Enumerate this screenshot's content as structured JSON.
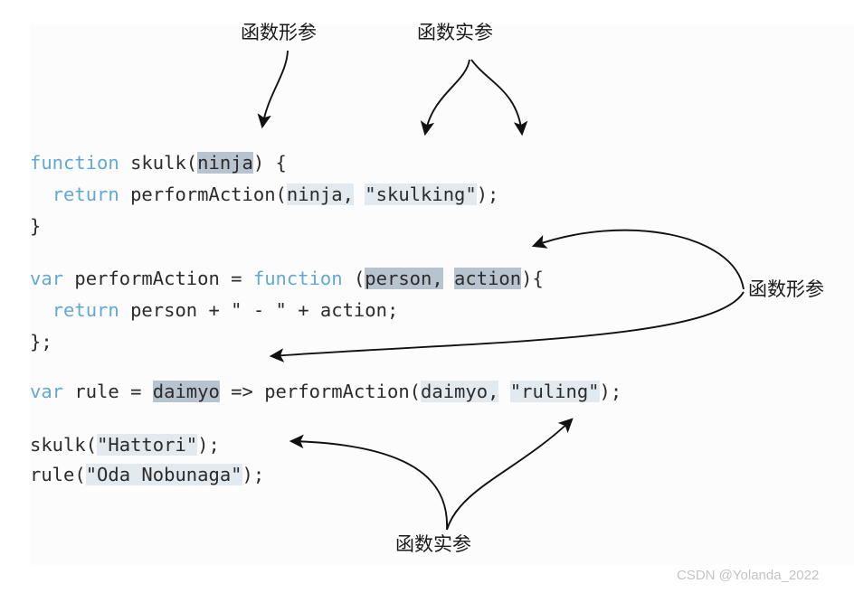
{
  "diagram": {
    "title": "JavaScript function parameters and arguments annotated diagram",
    "colors": {
      "keyword": "#62a8d6",
      "param_highlight": "#b7c3ce",
      "arg_highlight": "#e2eaf0",
      "code_text": "#2b2b2b",
      "panel_bg": "#fcfcfc",
      "arrow": "#1a1a1a",
      "watermark": "#c3c3c3"
    },
    "code_lines": [
      {
        "id": "line-1",
        "segments": [
          {
            "text": "function",
            "style": "keyword"
          },
          {
            "text": " skulk(",
            "style": "plain"
          },
          {
            "text": "ninja",
            "style": "param"
          },
          {
            "text": ") {",
            "style": "plain"
          }
        ]
      },
      {
        "id": "line-2",
        "segments": [
          {
            "text": "  ",
            "style": "plain"
          },
          {
            "text": "return",
            "style": "keyword"
          },
          {
            "text": " performAction(",
            "style": "plain"
          },
          {
            "text": "ninja,",
            "style": "arg"
          },
          {
            "text": " ",
            "style": "plain"
          },
          {
            "text": "\"skulking\"",
            "style": "arg"
          },
          {
            "text": ");",
            "style": "plain"
          }
        ]
      },
      {
        "id": "line-3",
        "segments": [
          {
            "text": "}",
            "style": "plain"
          }
        ]
      },
      {
        "id": "line-4",
        "segments": [
          {
            "text": "var",
            "style": "keyword"
          },
          {
            "text": " performAction = ",
            "style": "plain"
          },
          {
            "text": "function",
            "style": "keyword"
          },
          {
            "text": " (",
            "style": "plain"
          },
          {
            "text": "person,",
            "style": "param"
          },
          {
            "text": " ",
            "style": "plain"
          },
          {
            "text": "action",
            "style": "param"
          },
          {
            "text": "){",
            "style": "plain"
          }
        ]
      },
      {
        "id": "line-5",
        "segments": [
          {
            "text": "  ",
            "style": "plain"
          },
          {
            "text": "return",
            "style": "keyword"
          },
          {
            "text": " person + \" - \" + action;",
            "style": "plain"
          }
        ]
      },
      {
        "id": "line-6",
        "segments": [
          {
            "text": "};",
            "style": "plain"
          }
        ]
      },
      {
        "id": "line-7",
        "segments": [
          {
            "text": "var",
            "style": "keyword"
          },
          {
            "text": " rule = ",
            "style": "plain"
          },
          {
            "text": "daimyo",
            "style": "param"
          },
          {
            "text": " => performAction(",
            "style": "plain"
          },
          {
            "text": "daimyo,",
            "style": "arg"
          },
          {
            "text": " ",
            "style": "plain"
          },
          {
            "text": "\"ruling\"",
            "style": "arg"
          },
          {
            "text": ");",
            "style": "plain"
          }
        ]
      },
      {
        "id": "line-8",
        "segments": [
          {
            "text": "skulk(",
            "style": "plain"
          },
          {
            "text": "\"Hattori\"",
            "style": "arg"
          },
          {
            "text": ");",
            "style": "plain"
          }
        ]
      },
      {
        "id": "line-9",
        "segments": [
          {
            "text": "rule(",
            "style": "plain"
          },
          {
            "text": "\"Oda Nobunaga\"",
            "style": "arg"
          },
          {
            "text": ");",
            "style": "plain"
          }
        ]
      }
    ],
    "annotations": [
      {
        "id": "top-left",
        "text": "函数形参",
        "meaning": "formal-parameters",
        "targets": [
          "ninja"
        ]
      },
      {
        "id": "top-right",
        "text": "函数实参",
        "meaning": "actual-arguments",
        "targets": [
          "ninja",
          "\"skulking\""
        ]
      },
      {
        "id": "right",
        "text": "函数形参",
        "meaning": "formal-parameters",
        "targets": [
          "person, action",
          "daimyo"
        ]
      },
      {
        "id": "bottom",
        "text": "函数实参",
        "meaning": "actual-arguments",
        "targets": [
          "\"Hattori\"",
          "\"ruling\""
        ]
      }
    ],
    "watermark": "CSDN @Yolanda_2022"
  }
}
